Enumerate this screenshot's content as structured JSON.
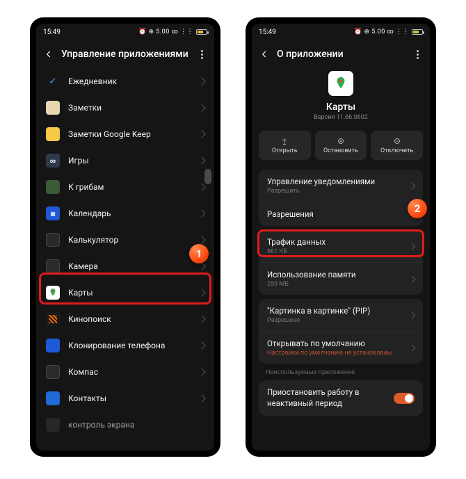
{
  "status": {
    "time": "15:49",
    "indicators": "⏰ ⊕ 5.00 ∞ ⋮⋮",
    "battery_pct": 55
  },
  "left": {
    "header_title": "Управление приложениями",
    "apps": [
      {
        "label": "Ежедневник"
      },
      {
        "label": "Заметки"
      },
      {
        "label": "Заметки Google Keep"
      },
      {
        "label": "Игры"
      },
      {
        "label": "К грибам"
      },
      {
        "label": "Календарь"
      },
      {
        "label": "Калькулятор"
      },
      {
        "label": "Камера"
      },
      {
        "label": "Карты"
      },
      {
        "label": "Кинопоиск"
      },
      {
        "label": "Клонирование телефона"
      },
      {
        "label": "Компас"
      },
      {
        "label": "Контакты"
      },
      {
        "label": "контроль экрана"
      }
    ],
    "badge": "1"
  },
  "right": {
    "header_title": "О приложении",
    "app_name": "Карты",
    "app_version": "Версия 11.66.0602",
    "actions": {
      "open": "Открыть",
      "stop": "Остановить",
      "disable": "Отключить"
    },
    "rows": {
      "notifications": {
        "title": "Управление уведомлениями",
        "sub": "Разрешить"
      },
      "permissions": {
        "title": "Разрешения"
      },
      "traffic": {
        "title": "Трафик данных",
        "sub": "661 КБ"
      },
      "memory": {
        "title": "Использование памяти",
        "sub": "259 МБ"
      },
      "pip": {
        "title": "\"Картинка в картинке\" (PIP)",
        "sub": "Разрешено"
      },
      "default": {
        "title": "Открывать по умолчанию",
        "sub": "Настройки по умолчанию не установлены"
      },
      "unused_label": "Неиспользуемые приложения",
      "suspend": {
        "title": "Приостановить работу в неактивный период"
      }
    },
    "badge": "2"
  }
}
